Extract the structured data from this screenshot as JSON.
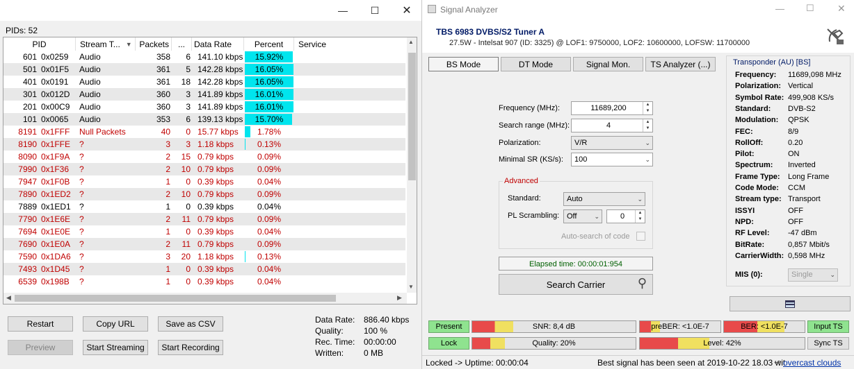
{
  "left": {
    "pids_label": "PIDs: 52",
    "columns": [
      "PID",
      "Stream T...",
      "Packets",
      "...",
      "Data Rate",
      "Percent",
      "Service"
    ],
    "rows": [
      {
        "pid": "601",
        "hex": "0x0259",
        "type": "Audio",
        "packets": "358",
        "cc": "6",
        "rate": "141.10 kbps",
        "pct": "15.92%",
        "fill": 0.1592,
        "color": "#000000"
      },
      {
        "pid": "501",
        "hex": "0x01F5",
        "type": "Audio",
        "packets": "361",
        "cc": "5",
        "rate": "142.28 kbps",
        "pct": "16.05%",
        "fill": 0.1605,
        "color": "#000000"
      },
      {
        "pid": "401",
        "hex": "0x0191",
        "type": "Audio",
        "packets": "361",
        "cc": "18",
        "rate": "142.28 kbps",
        "pct": "16.05%",
        "fill": 0.1605,
        "color": "#000000"
      },
      {
        "pid": "301",
        "hex": "0x012D",
        "type": "Audio",
        "packets": "360",
        "cc": "3",
        "rate": "141.89 kbps",
        "pct": "16.01%",
        "fill": 0.1601,
        "color": "#000000"
      },
      {
        "pid": "201",
        "hex": "0x00C9",
        "type": "Audio",
        "packets": "360",
        "cc": "3",
        "rate": "141.89 kbps",
        "pct": "16.01%",
        "fill": 0.1601,
        "color": "#000000"
      },
      {
        "pid": "101",
        "hex": "0x0065",
        "type": "Audio",
        "packets": "353",
        "cc": "6",
        "rate": "139.13 kbps",
        "pct": "15.70%",
        "fill": 0.157,
        "color": "#000000"
      },
      {
        "pid": "8191",
        "hex": "0x1FFF",
        "type": "Null Packets",
        "packets": "40",
        "cc": "0",
        "rate": "15.77 kbps",
        "pct": "1.78%",
        "fill": 0.0178,
        "color": "#c00000"
      },
      {
        "pid": "8190",
        "hex": "0x1FFE",
        "type": "?",
        "packets": "3",
        "cc": "3",
        "rate": "1.18 kbps",
        "pct": "0.13%",
        "fill": 0.0013,
        "color": "#c00000"
      },
      {
        "pid": "8090",
        "hex": "0x1F9A",
        "type": "?",
        "packets": "2",
        "cc": "15",
        "rate": "0.79 kbps",
        "pct": "0.09%",
        "fill": 0,
        "color": "#c00000"
      },
      {
        "pid": "7990",
        "hex": "0x1F36",
        "type": "?",
        "packets": "2",
        "cc": "10",
        "rate": "0.79 kbps",
        "pct": "0.09%",
        "fill": 0,
        "color": "#c00000"
      },
      {
        "pid": "7947",
        "hex": "0x1F0B",
        "type": "?",
        "packets": "1",
        "cc": "0",
        "rate": "0.39 kbps",
        "pct": "0.04%",
        "fill": 0,
        "color": "#c00000"
      },
      {
        "pid": "7890",
        "hex": "0x1ED2",
        "type": "?",
        "packets": "2",
        "cc": "10",
        "rate": "0.79 kbps",
        "pct": "0.09%",
        "fill": 0,
        "color": "#c00000"
      },
      {
        "pid": "7889",
        "hex": "0x1ED1",
        "type": "?",
        "packets": "1",
        "cc": "0",
        "rate": "0.39 kbps",
        "pct": "0.04%",
        "fill": 0,
        "color": "#000000"
      },
      {
        "pid": "7790",
        "hex": "0x1E6E",
        "type": "?",
        "packets": "2",
        "cc": "11",
        "rate": "0.79 kbps",
        "pct": "0.09%",
        "fill": 0,
        "color": "#c00000"
      },
      {
        "pid": "7694",
        "hex": "0x1E0E",
        "type": "?",
        "packets": "1",
        "cc": "0",
        "rate": "0.39 kbps",
        "pct": "0.04%",
        "fill": 0,
        "color": "#c00000"
      },
      {
        "pid": "7690",
        "hex": "0x1E0A",
        "type": "?",
        "packets": "2",
        "cc": "11",
        "rate": "0.79 kbps",
        "pct": "0.09%",
        "fill": 0,
        "color": "#c00000"
      },
      {
        "pid": "7590",
        "hex": "0x1DA6",
        "type": "?",
        "packets": "3",
        "cc": "20",
        "rate": "1.18 kbps",
        "pct": "0.13%",
        "fill": 0.0013,
        "color": "#c00000"
      },
      {
        "pid": "7493",
        "hex": "0x1D45",
        "type": "?",
        "packets": "1",
        "cc": "0",
        "rate": "0.39 kbps",
        "pct": "0.04%",
        "fill": 0,
        "color": "#c00000"
      },
      {
        "pid": "6539",
        "hex": "0x198B",
        "type": "?",
        "packets": "1",
        "cc": "0",
        "rate": "0.39 kbps",
        "pct": "0.04%",
        "fill": 0,
        "color": "#c00000"
      }
    ],
    "buttons": {
      "restart": "Restart",
      "copy_url": "Copy URL",
      "save_csv": "Save as CSV",
      "preview": "Preview",
      "start_streaming": "Start Streaming",
      "start_recording": "Start Recording"
    },
    "stats": {
      "data_rate_label": "Data Rate:",
      "data_rate": "886.40 kbps",
      "quality_label": "Quality:",
      "quality": "100 %",
      "rec_time_label": "Rec. Time:",
      "rec_time": "00:00:00",
      "written_label": "Written:",
      "written": "0 MB"
    }
  },
  "right": {
    "window_title": "Signal Analyzer",
    "tuner_name": "TBS 6983 DVBS/S2 Tuner A",
    "tuner_info": "27.5W - Intelsat 907 (ID: 3325) @ LOF1: 9750000, LOF2: 10600000, LOFSW: 11700000",
    "tabs": [
      "BS Mode",
      "DT Mode",
      "Signal Mon.",
      "TS Analyzer (...)"
    ],
    "form": {
      "frequency_label": "Frequency (MHz):",
      "frequency": "11689,200",
      "search_range_label": "Search range (MHz):",
      "search_range": "4",
      "polarization_label": "Polarization:",
      "polarization": "V/R",
      "min_sr_label": "Minimal SR (KS/s):",
      "min_sr": "100",
      "advanced_label": "Advanced",
      "standard_label": "Standard:",
      "standard": "Auto",
      "pl_label": "PL Scrambling:",
      "pl_mode": "Off",
      "pl_value": "0",
      "auto_search_label": "Auto-search of code",
      "elapsed": "Elapsed time: 00:00:01:954",
      "search_button": "Search Carrier"
    },
    "transponder": {
      "title": "Transponder (AU) [BS]",
      "items": [
        {
          "label": "Frequency:",
          "value": "11689,098 MHz"
        },
        {
          "label": "Polarization:",
          "value": "Vertical"
        },
        {
          "label": "Symbol Rate:",
          "value": "499,908 KS/s"
        },
        {
          "label": "Standard:",
          "value": "DVB-S2"
        },
        {
          "label": "Modulation:",
          "value": "QPSK"
        },
        {
          "label": "FEC:",
          "value": "8/9"
        },
        {
          "label": "RollOff:",
          "value": "0.20"
        },
        {
          "label": "Pilot:",
          "value": "ON"
        },
        {
          "label": "Spectrum:",
          "value": "Inverted"
        },
        {
          "label": "Frame Type:",
          "value": "Long Frame"
        },
        {
          "label": "Code Mode:",
          "value": "CCM"
        },
        {
          "label": "Stream type:",
          "value": "Transport"
        },
        {
          "label": "ISSYI",
          "value": "OFF"
        },
        {
          "label": "NPD:",
          "value": "OFF"
        },
        {
          "label": "RF Level:",
          "value": "-47 dBm"
        },
        {
          "label": "BitRate:",
          "value": "0,857 Mbit/s"
        },
        {
          "label": "CarrierWidth:",
          "value": "0,598 MHz"
        }
      ],
      "mis_label": "MIS (0):",
      "mis_value": "Single"
    },
    "meters": {
      "present": "Present",
      "lock": "Lock",
      "snr": "SNR: 8,4 dB",
      "snr_fill": 0.25,
      "quality": "Quality: 20%",
      "quality_fill": 0.2,
      "prebers": "preBER: <1.0E-7",
      "preber_fill": 0.25,
      "ber": "BER: <1.0E-7",
      "ber_fill": 0.75,
      "level": "Level: 42%",
      "level_fill": 0.42,
      "input_ts": "Input TS",
      "sync_ts": "Sync TS"
    },
    "status": {
      "uptime": "Locked -> Uptime: 00:00:04",
      "best": "Best signal has been seen at 2019-10-22 18.03 wit",
      "link": "overcast clouds"
    }
  }
}
